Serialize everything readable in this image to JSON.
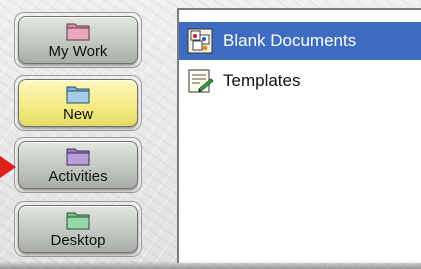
{
  "nav": {
    "items": [
      {
        "label": "My Work",
        "icon": "folder-pink-icon",
        "folder_color": "#d98aa8"
      },
      {
        "label": "New",
        "icon": "folder-blue-icon",
        "folder_color": "#7fb2d8"
      },
      {
        "label": "Activities",
        "icon": "folder-purple-icon",
        "folder_color": "#9b7cc4"
      },
      {
        "label": "Desktop",
        "icon": "folder-green-icon",
        "folder_color": "#6fbf86"
      }
    ],
    "active": "New"
  },
  "list": {
    "items": [
      {
        "label": "Blank Documents",
        "icon": "blank-documents-icon",
        "selected": true
      },
      {
        "label": "Templates",
        "icon": "templates-icon",
        "selected": false
      }
    ],
    "selection_color": "#3d6cc0"
  },
  "pointer": {
    "icon": "red-arrow-icon",
    "color": "#e0201a"
  }
}
